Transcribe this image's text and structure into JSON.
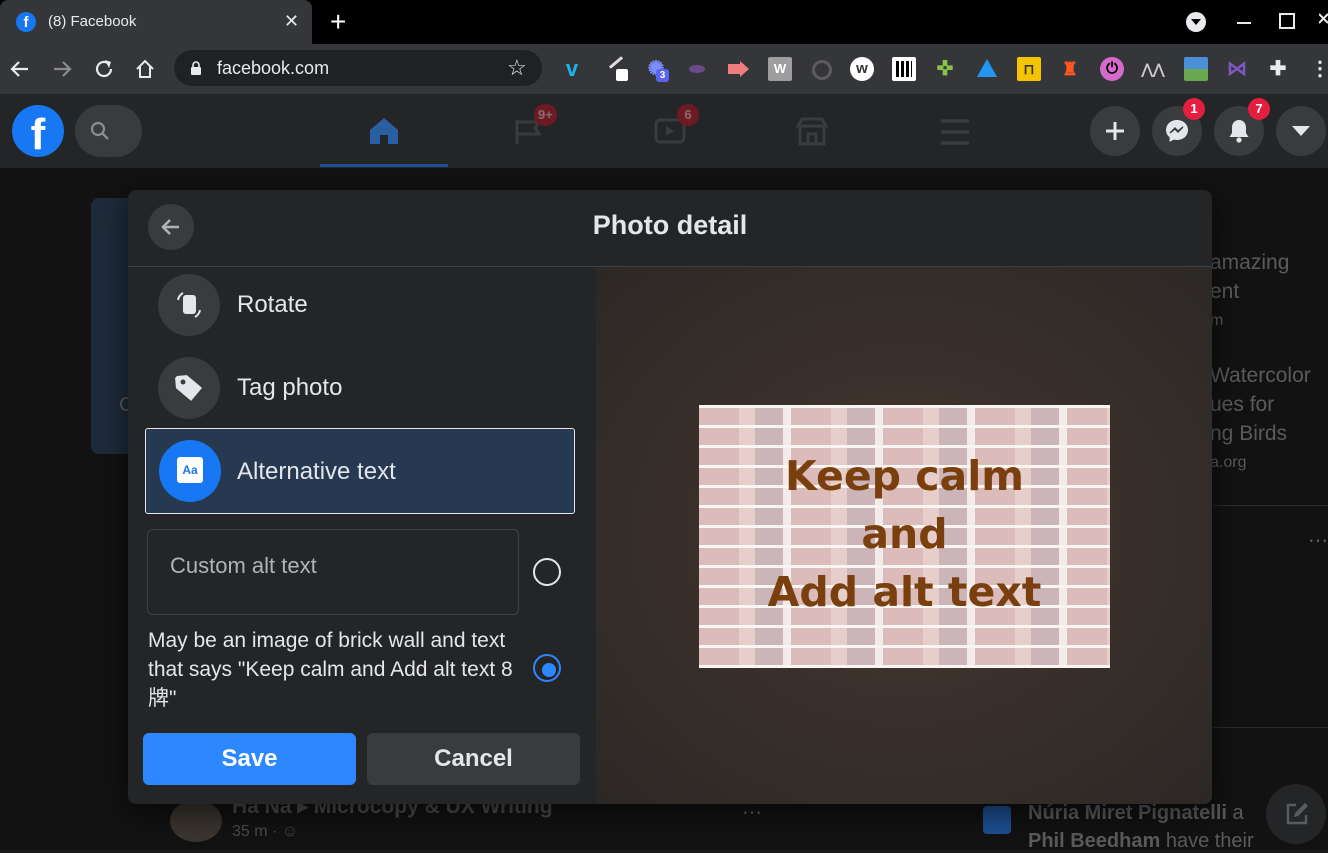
{
  "browser": {
    "tab_title": "(8) Facebook",
    "tab_favicon": "f",
    "close_glyph": "✕",
    "new_tab_glyph": "+",
    "url": "facebook.com",
    "extension_badge": "3"
  },
  "facebook": {
    "logo": "f",
    "badges": {
      "groups": "9+",
      "watch": "6",
      "messenger": "1",
      "notifications": "7"
    }
  },
  "background": {
    "sidebar_lines": [
      "amazing",
      "ent",
      "m",
      "Watercolor",
      "ues for",
      "ng Birds",
      "a.org"
    ],
    "post_author": "Ha Na ▸ Microcopy & UX Writing",
    "post_time": "35 m · ",
    "birthday_text_1": "Núria Miret Pignatelli",
    "birthday_text_1_suffix": " a",
    "birthday_text_2": "Phil Beedham",
    "birthday_text_2_suffix": " have their",
    "left_fragment": "C"
  },
  "modal": {
    "title": "Photo detail",
    "menu": [
      {
        "label": "Rotate",
        "icon": "rotate-icon"
      },
      {
        "label": "Tag photo",
        "icon": "tag-icon"
      },
      {
        "label": "Alternative text",
        "icon": "alt-text-icon"
      }
    ],
    "alt_icon_text": "Aa",
    "custom_alt_placeholder": "Custom alt text",
    "auto_alt_text": "May be an image of brick wall and text that says \"Keep calm and Add alt text 8牌\"",
    "selected_option": "auto",
    "save_label": "Save",
    "cancel_label": "Cancel",
    "photo_text_lines": [
      "Keep calm",
      "and",
      "Add alt text"
    ]
  },
  "colors": {
    "accent": "#2d88ff",
    "brand": "#1877f2",
    "badge": "#e41e3f",
    "modal_bg": "#242526",
    "photo_text": "#7a3f0f"
  }
}
